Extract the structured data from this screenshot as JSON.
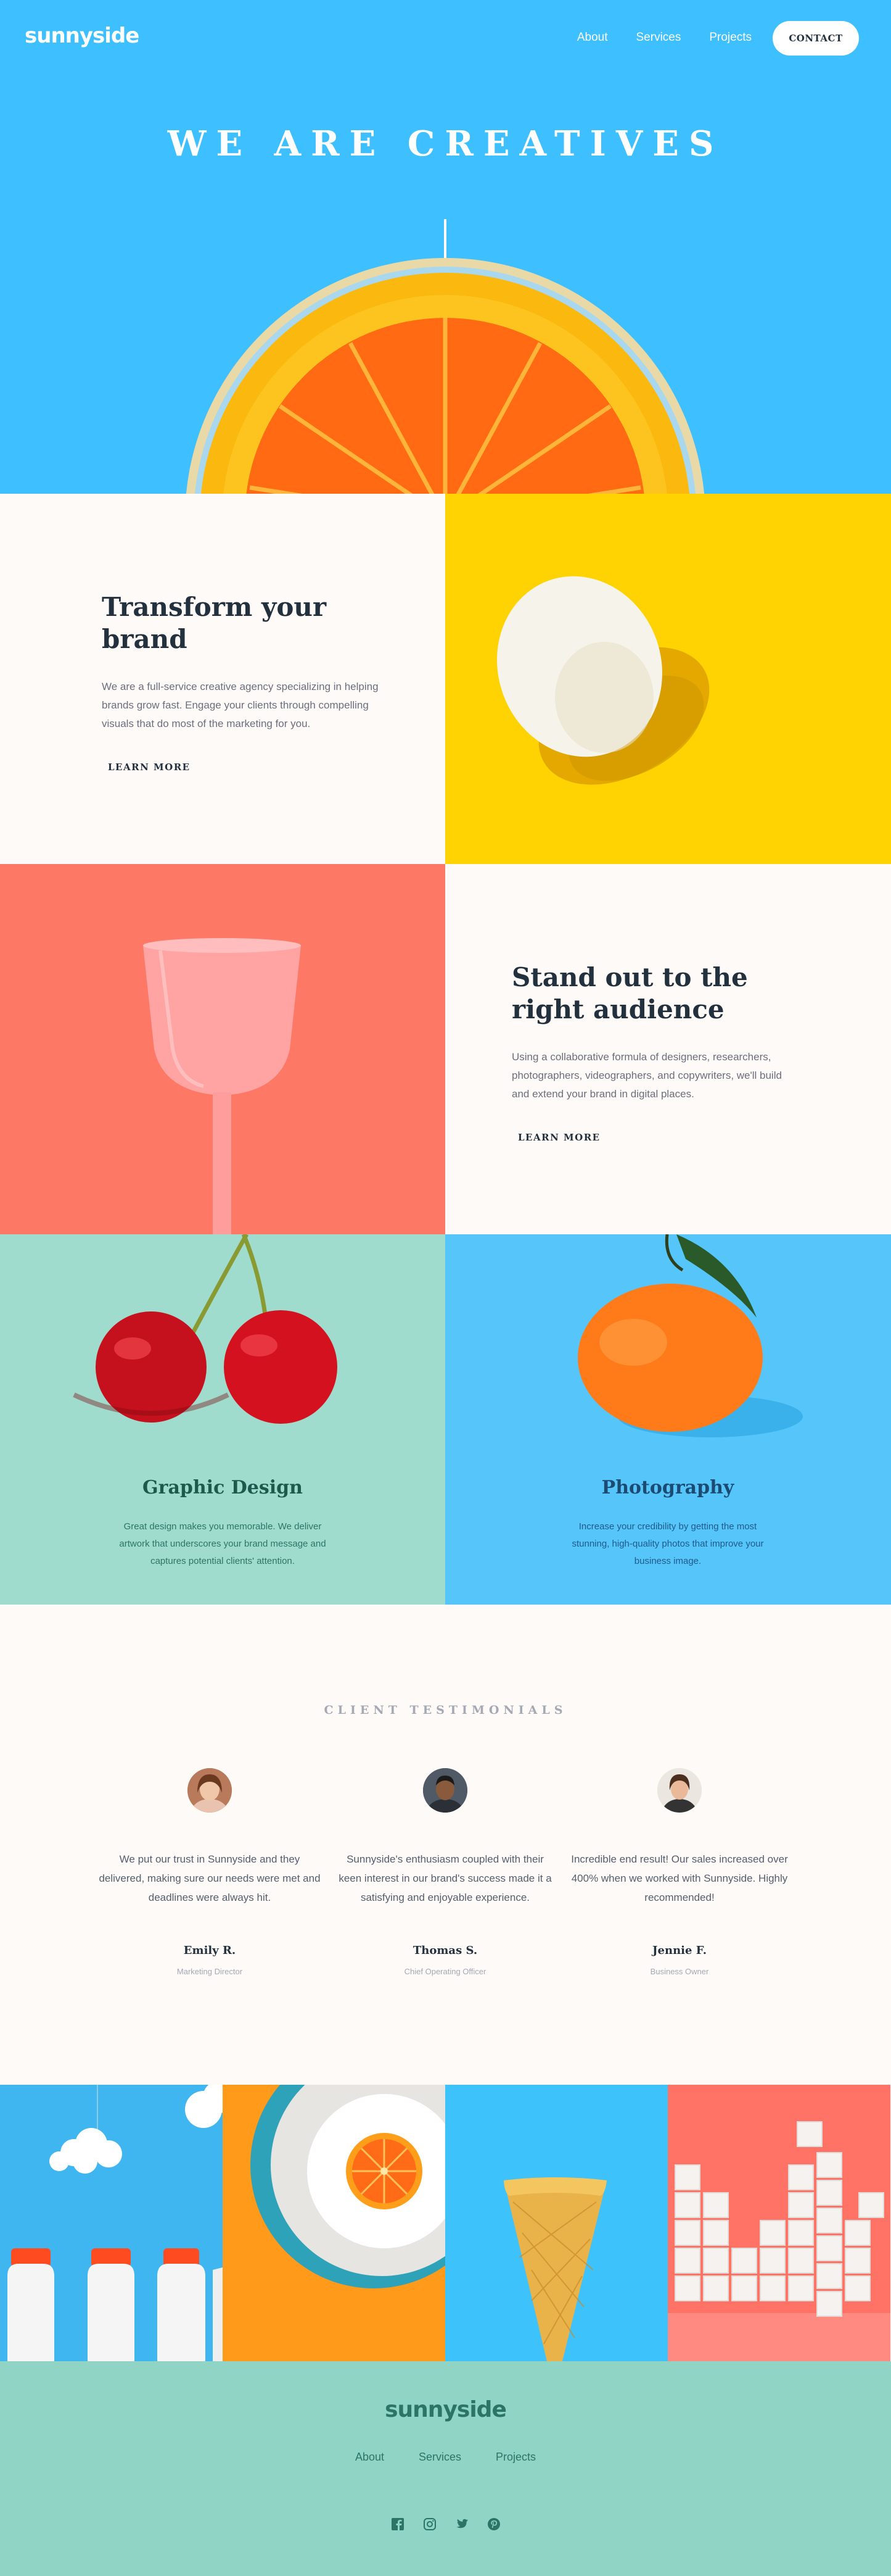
{
  "nav": {
    "logo": "sunnyside",
    "links": [
      "About",
      "Services",
      "Projects"
    ],
    "contact": "CONTACT"
  },
  "hero": {
    "title": "WE ARE CREATIVES"
  },
  "transform": {
    "title": "Transform your brand",
    "body": "We are a full-service creative agency specializing in helping brands grow fast. Engage your clients through compelling visuals that do most of the marketing for you.",
    "cta": "LEARN MORE"
  },
  "standout": {
    "title": "Stand out to the right audience",
    "body": "Using a collaborative formula of designers, researchers, photographers, videographers, and copywriters, we'll build and extend your brand in digital places.",
    "cta": "LEARN MORE"
  },
  "services": [
    {
      "title": "Graphic Design",
      "body": "Great design makes you memorable. We deliver artwork that underscores your brand message and captures potential clients' attention."
    },
    {
      "title": "Photography",
      "body": "Increase your credibility by getting the most stunning, high-quality photos that improve your business image."
    }
  ],
  "testimonials": {
    "heading": "CLIENT TESTIMONIALS",
    "items": [
      {
        "quote": "We put our trust in Sunnyside and they delivered, making sure our needs were met and deadlines were always hit.",
        "name": "Emily R.",
        "role": "Marketing Director"
      },
      {
        "quote": "Sunnyside's enthusiasm coupled with their keen interest in our brand's success made it a satisfying and enjoyable experience.",
        "name": "Thomas S.",
        "role": "Chief Operating Officer"
      },
      {
        "quote": "Incredible end result! Our sales increased over 400% when we worked with Sunnyside. Highly recommended!",
        "name": "Jennie F.",
        "role": "Business Owner"
      }
    ]
  },
  "footer": {
    "logo": "sunnyside",
    "links": [
      "About",
      "Services",
      "Projects"
    ],
    "social_icons": [
      "facebook-icon",
      "instagram-icon",
      "twitter-icon",
      "pinterest-icon"
    ]
  },
  "colors": {
    "hero_bg": "#3ebfff",
    "yellow": "#fed301",
    "coral": "#fe7866",
    "teal": "#90d4c5",
    "footer_text": "#2c7566"
  }
}
